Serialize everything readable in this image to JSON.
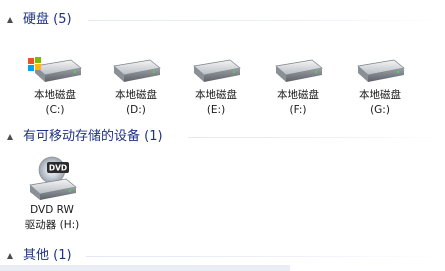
{
  "groups": {
    "hard_disks": {
      "title": "硬盘 (5)",
      "drives": [
        {
          "name": "本地磁盘",
          "letter": "(C:)",
          "icon": "system-drive-icon"
        },
        {
          "name": "本地磁盘",
          "letter": "(D:)",
          "icon": "hard-drive-icon"
        },
        {
          "name": "本地磁盘",
          "letter": "(E:)",
          "icon": "hard-drive-icon"
        },
        {
          "name": "本地磁盘",
          "letter": "(F:)",
          "icon": "hard-drive-icon"
        },
        {
          "name": "本地磁盘",
          "letter": "(G:)",
          "icon": "hard-drive-icon"
        }
      ]
    },
    "removable": {
      "title": "有可移动存储的设备 (1)",
      "drives": [
        {
          "name": "DVD RW",
          "letter": "驱动器 (H:)",
          "icon": "dvd-drive-icon",
          "badge": "DVD"
        }
      ]
    },
    "other": {
      "title": "其他 (1)"
    }
  },
  "colors": {
    "group_title": "#1e3287",
    "label_text": "#1a1a1a",
    "windows_flag": [
      "#f25022",
      "#7fba00",
      "#00a4ef",
      "#ffb900"
    ]
  }
}
